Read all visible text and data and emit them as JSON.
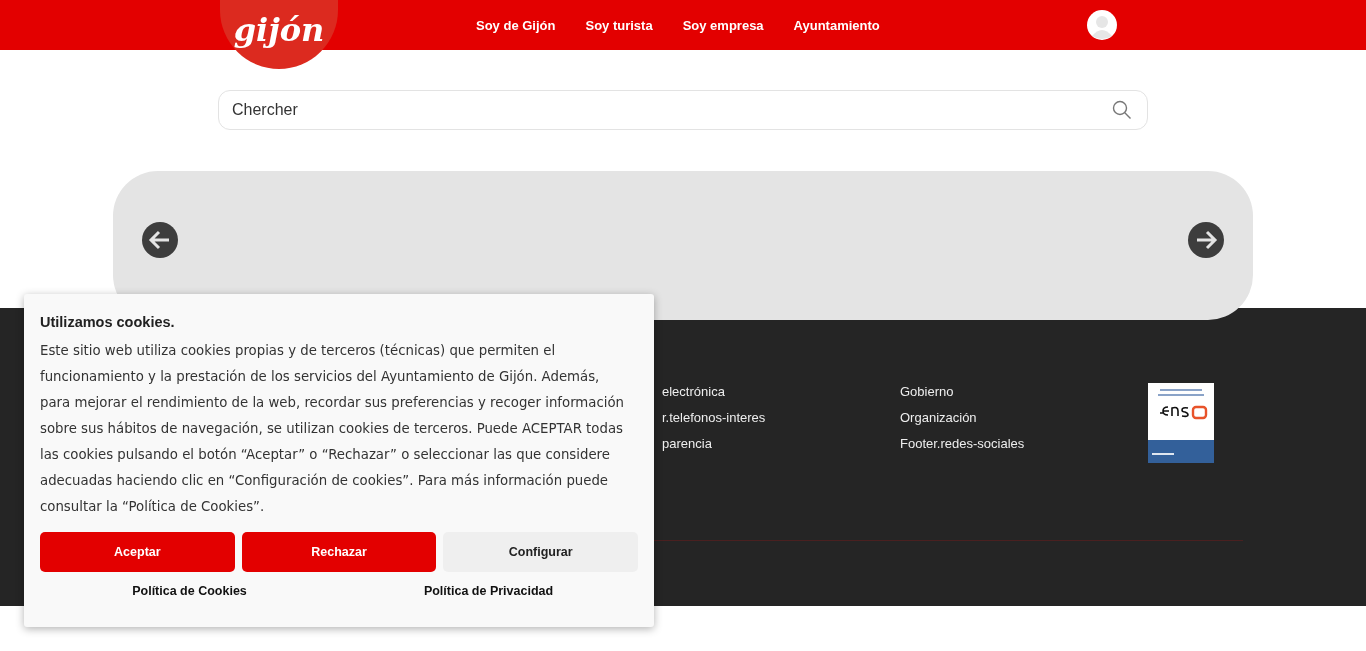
{
  "header": {
    "logo": "gijón",
    "nav": [
      "Soy de Gijón",
      "Soy turista",
      "Soy empresa",
      "Ayuntamiento"
    ]
  },
  "search": {
    "placeholder": "Chercher"
  },
  "footer": {
    "columns": [
      [
        "electrónica",
        "r.telefonos-interes",
        "parencia"
      ],
      [
        "Gobierno",
        "Organización",
        "Footer.redes-sociales"
      ]
    ]
  },
  "cookie_dialog": {
    "title": "Utilizamos cookies.",
    "body": "Este sitio web utiliza cookies propias y de terceros (técnicas) que permiten el funcionamiento y la prestación de los servicios del Ayuntamiento de Gijón. Además, para mejorar el rendimiento de la web, recordar sus preferencias y recoger información sobre sus hábitos de navegación, se utilizan cookies de terceros. Puede ACEPTAR todas las cookies pulsando el botón “Aceptar” o “Rechazar” o seleccionar las que considere adecuadas haciendo clic en “Configuración de cookies”. Para más información puede consultar la “Política de Cookies”.",
    "buttons": [
      {
        "label": "Aceptar",
        "kind": "primary"
      },
      {
        "label": "Rechazar",
        "kind": "primary"
      },
      {
        "label": "Configurar",
        "kind": "secondary"
      }
    ],
    "links": [
      "Política de Cookies",
      "Política de Privacidad"
    ]
  }
}
